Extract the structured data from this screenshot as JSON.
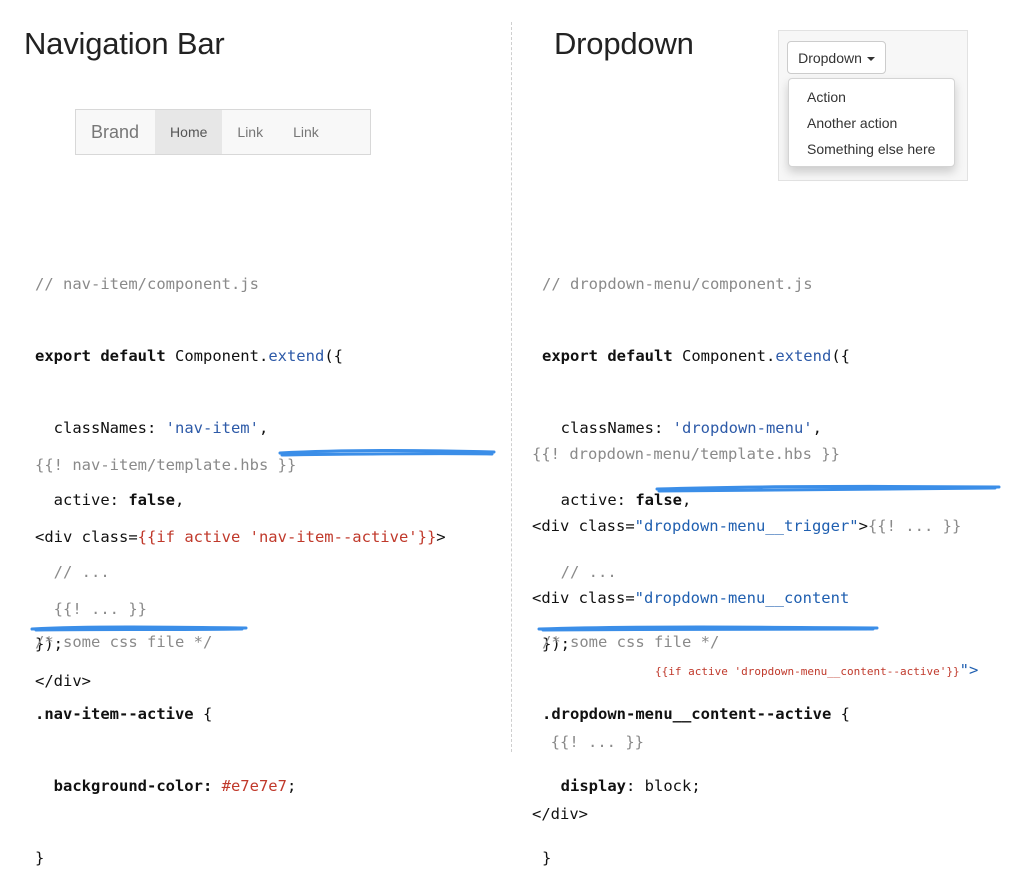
{
  "left": {
    "heading": "Navigation Bar",
    "navbar": {
      "brand": "Brand",
      "links": [
        "Home",
        "Link",
        "Link"
      ],
      "active_index": 0
    },
    "js": {
      "comment": "// nav-item/component.js",
      "line1_kw": "export default",
      "line1_rest_a": " Component.",
      "line1_fn": "extend",
      "line1_rest_b": "({",
      "classnames_key": "  classNames: ",
      "classnames_val": "'nav-item'",
      "classnames_end": ",",
      "active_key": "  active: ",
      "active_val": "false",
      "active_end": ",",
      "ellipsis": "  // ...",
      "close": "});"
    },
    "hbs": {
      "comment": "{{! nav-item/template.hbs }}",
      "div_open_a": "<div class=",
      "div_open_hbs": "{{if active 'nav-item--active'}}",
      "div_open_b": ">",
      "inner": "  {{! ... }}",
      "div_close": "</div>"
    },
    "css": {
      "comment": "/* some css file */",
      "selector": ".nav-item--active",
      "brace": " {",
      "prop_key": "  background-color: ",
      "prop_val": "#e7e7e7",
      "prop_end": ";",
      "close": "}"
    }
  },
  "right": {
    "heading": "Dropdown",
    "dropdown": {
      "button_label": "Dropdown",
      "items": [
        "Action",
        "Another action",
        "Something else here"
      ]
    },
    "js": {
      "comment": "// dropdown-menu/component.js",
      "line1_kw": "export default",
      "line1_rest_a": " Component.",
      "line1_fn": "extend",
      "line1_rest_b": "({",
      "classnames_key": "  classNames: ",
      "classnames_val": "'dropdown-menu'",
      "classnames_end": ",",
      "active_key": "  active: ",
      "active_val": "false",
      "active_end": ",",
      "ellipsis": "  // ...",
      "close": "});"
    },
    "hbs": {
      "comment": "{{! dropdown-menu/template.hbs }}",
      "trigger_a": "<div class=",
      "trigger_cls": "\"dropdown-menu__trigger\"",
      "trigger_b": ">",
      "trigger_inner": "{{! ... }}",
      "content_a": "<div class=",
      "content_cls": "\"dropdown-menu__content",
      "content_hbs": "{{if active 'dropdown-menu__content--active'}}",
      "content_end": "\">",
      "inner": "  {{! ... }}",
      "div_close": "</div>"
    },
    "css": {
      "comment": "/* some css file */",
      "selector": ".dropdown-menu__content--active",
      "brace": " {",
      "prop_key": "  display",
      "prop_colon": ": block;",
      "close": "}"
    }
  },
  "colors": {
    "scribble": "#3b8ee8",
    "hbs_red": "#c0392b",
    "string_blue": "#2d5aa8"
  }
}
